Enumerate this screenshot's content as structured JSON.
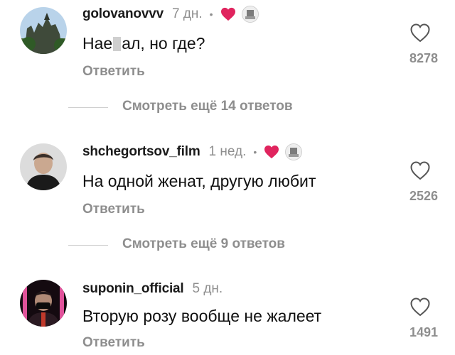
{
  "comments": [
    {
      "username": "golovanovvv",
      "time": "7 дн.",
      "dot": "•",
      "text_before": "Нае",
      "text_after": "ал, но где?",
      "reply": "Ответить",
      "likes": "8278",
      "creator_liked": true,
      "more_replies": "Смотреть ещё 14 ответов"
    },
    {
      "username": "shchegortsov_film",
      "time": "1 нед.",
      "dot": "•",
      "text": "На одной женат, другую любит",
      "reply": "Ответить",
      "likes": "2526",
      "creator_liked": true,
      "more_replies": "Смотреть ещё 9 ответов"
    },
    {
      "username": "suponin_official",
      "time": "5 дн.",
      "text": "Вторую розу вообще не жалеет",
      "reply": "Ответить",
      "likes": "1491",
      "creator_liked": false
    }
  ],
  "colors": {
    "creator_heart": "#e0245e",
    "secondary_text": "#8e8e8e",
    "divider": "#cfcfcf"
  },
  "icons": {
    "like": "heart-outline-icon",
    "creator_like": "heart-filled-icon"
  }
}
